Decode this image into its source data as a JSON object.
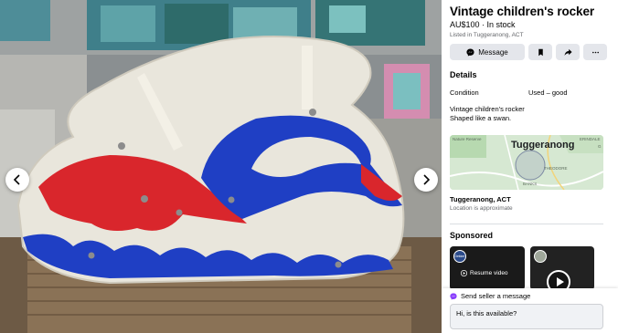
{
  "viewer": {
    "prev_icon": "chevron-left-icon",
    "next_icon": "chevron-right-icon"
  },
  "listing": {
    "title": "Vintage children's rocker",
    "price": "AU$100",
    "separator": " · ",
    "stock": "In stock",
    "listed_in": "Listed in Tuggeranong, ACT"
  },
  "actions": {
    "message_label": "Message",
    "message_icon": "messenger-icon",
    "save_icon": "bookmark-icon",
    "share_icon": "share-arrow-icon",
    "more_icon": "more-dots-icon"
  },
  "details": {
    "heading": "Details",
    "condition_label": "Condition",
    "condition_value": "Used – good",
    "description_lines": [
      "Vintage children's rocker",
      "Shaped like a swan."
    ]
  },
  "map": {
    "town": "Tuggeranong",
    "labels": [
      "Nature Reserve",
      "ERINDALE",
      "THEODORE",
      "BANKS",
      "G"
    ]
  },
  "location": {
    "name": "Tuggeranong, ACT",
    "note": "Location is approximate"
  },
  "sponsored": {
    "heading": "Sponsored",
    "ad1_logo": "Dekker",
    "ad1_cta": "Resume video"
  },
  "send": {
    "label": "Send seller a message",
    "input_value": "Hi, is this available?"
  },
  "colors": {
    "button_bg": "#e4e6eb",
    "swan_blue": "#1f3fc4",
    "swan_red": "#d9262c",
    "messenger": "#8a3ffc"
  }
}
